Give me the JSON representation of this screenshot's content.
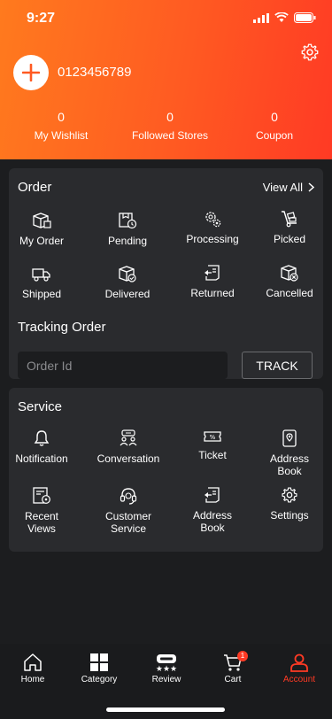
{
  "status_bar": {
    "time": "9:27"
  },
  "profile": {
    "phone": "0123456789"
  },
  "stats": [
    {
      "value": "0",
      "label": "My Wishlist"
    },
    {
      "value": "0",
      "label": "Followed Stores"
    },
    {
      "value": "0",
      "label": "Coupon"
    }
  ],
  "order": {
    "title": "Order",
    "view_all": "View All",
    "items": [
      "My Order",
      "Pending",
      "Processing",
      "Picked",
      "Shipped",
      "Delivered",
      "Returned",
      "Cancelled"
    ]
  },
  "tracking": {
    "title": "Tracking Order",
    "placeholder": "Order Id",
    "button": "TRACK"
  },
  "service": {
    "title": "Service",
    "items": [
      {
        "line1": "Notification",
        "line2": ""
      },
      {
        "line1": "Conversation",
        "line2": ""
      },
      {
        "line1": "Ticket",
        "line2": ""
      },
      {
        "line1": "Address",
        "line2": "Book"
      },
      {
        "line1": "Recent",
        "line2": "Views"
      },
      {
        "line1": "Customer",
        "line2": "Service"
      },
      {
        "line1": "Address",
        "line2": "Book"
      },
      {
        "line1": "Settings",
        "line2": ""
      }
    ]
  },
  "nav": {
    "items": [
      "Home",
      "Category",
      "Review",
      "Cart",
      "Account"
    ],
    "cart_badge": "1",
    "active_color": "#ff3a24"
  },
  "colors": {
    "accent": "#ff5a22",
    "card": "#2a2b2e",
    "background": "#1c1d1f"
  }
}
